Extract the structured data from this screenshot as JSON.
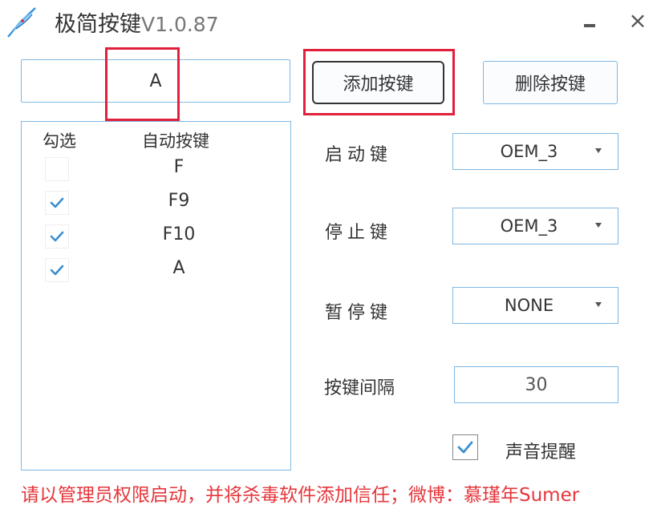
{
  "window": {
    "title": "极简按键",
    "version": "V1.0.87",
    "close_symbol": "×"
  },
  "key_input": {
    "value": "A"
  },
  "buttons": {
    "add": "添加按键",
    "delete": "删除按键"
  },
  "list": {
    "headers": {
      "check": "勾选",
      "key": "自动按键"
    },
    "rows": [
      {
        "key": "F",
        "checked": false
      },
      {
        "key": "F9",
        "checked": true
      },
      {
        "key": "F10",
        "checked": true
      },
      {
        "key": "A",
        "checked": true
      }
    ]
  },
  "settings": {
    "start": {
      "label": "启动键",
      "value": "OEM_3"
    },
    "stop": {
      "label": "停止键",
      "value": "OEM_3"
    },
    "pause": {
      "label": "暂停键",
      "value": "NONE"
    },
    "interval": {
      "label": "按键间隔",
      "value": "30"
    },
    "sound": {
      "label": "声音提醒",
      "checked": true
    }
  },
  "footer": "请以管理员权限启动，并将杀毒软件添加信任；微博：慕瑾年Sumer",
  "colors": {
    "accent_border": "#7fb8e3",
    "highlight": "#e0203c",
    "check": "#3a8fd0",
    "footer_text": "#e5363b"
  },
  "icons": {
    "app": "feather-quill-icon",
    "check": "checkmark-icon",
    "dropdown": "triangle-down-icon"
  }
}
